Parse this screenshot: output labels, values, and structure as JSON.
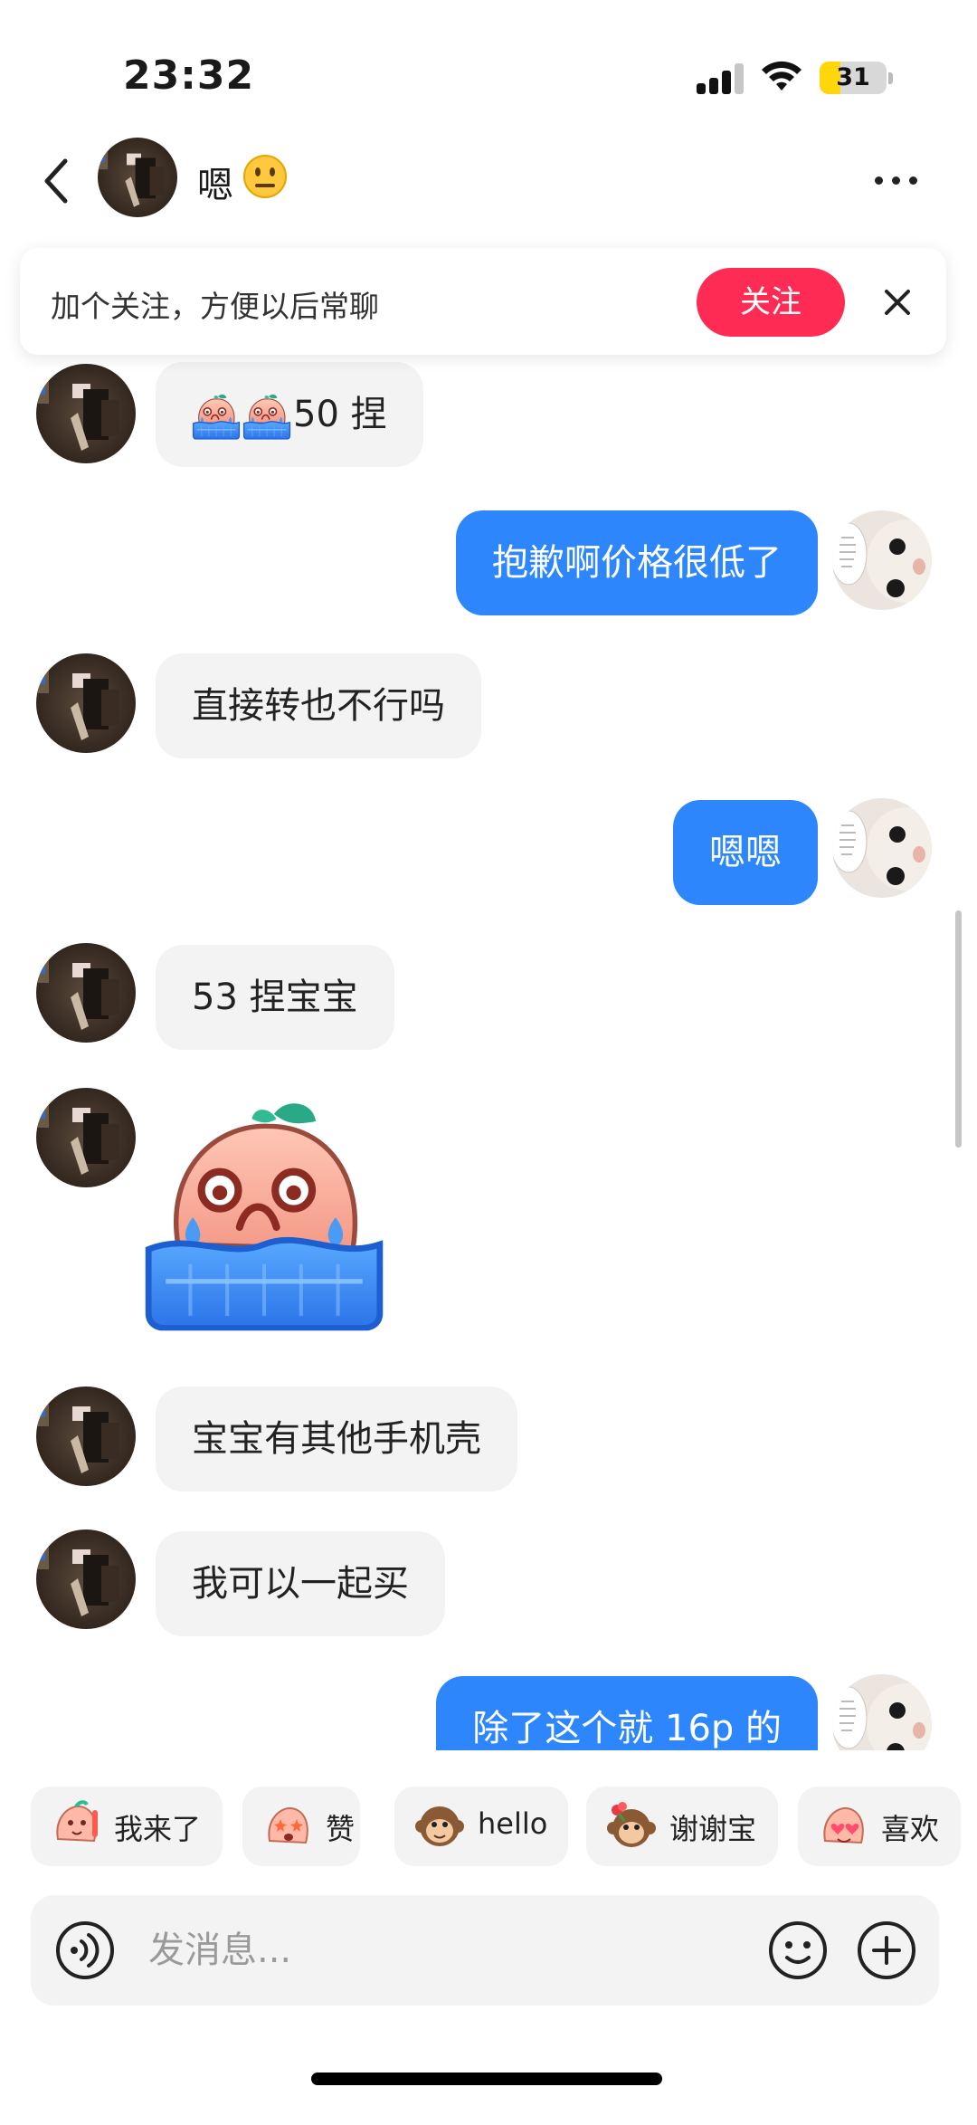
{
  "status_bar": {
    "time": "23:32",
    "battery": "31",
    "battery_level": 0.31
  },
  "header": {
    "name": "嗯",
    "name_emoji": "neutral-face-icon",
    "more_icon": "more-dots-icon"
  },
  "follow_banner": {
    "text": "加个关注，方便以后常聊",
    "button_label": "关注"
  },
  "messages": [
    {
      "from": "other",
      "text": "50 捏",
      "emoji_prefix": "crying-peach-sticker-icon x2"
    },
    {
      "from": "me",
      "text": "抱歉啊价格很低了"
    },
    {
      "from": "other",
      "text": "直接转也不行吗"
    },
    {
      "from": "me",
      "text": "嗯嗯"
    },
    {
      "from": "other",
      "text": "53 捏宝宝"
    },
    {
      "from": "other",
      "sticker": "crying-peach-sticker"
    },
    {
      "from": "other",
      "text": "宝宝有其他手机壳"
    },
    {
      "from": "other",
      "text": "我可以一起买"
    },
    {
      "from": "me",
      "text": "除了这个就 16p 的"
    }
  ],
  "quick_replies": [
    {
      "label": "我来了",
      "icon": "peach-wave-sticker-icon"
    },
    {
      "label": "赞",
      "icon": "peach-star-sticker-icon"
    },
    {
      "label": "hello",
      "icon": "monkey-sticker-icon"
    },
    {
      "label": "谢谢宝",
      "icon": "monkey-flower-sticker-icon"
    },
    {
      "label": "喜欢",
      "icon": "peach-heart-sticker-icon"
    }
  ],
  "input": {
    "placeholder": "发消息..."
  },
  "colors": {
    "accent_blue": "#2d86fb",
    "follow_red": "#fe2c55",
    "bubble_gray": "#f3f3f3"
  }
}
